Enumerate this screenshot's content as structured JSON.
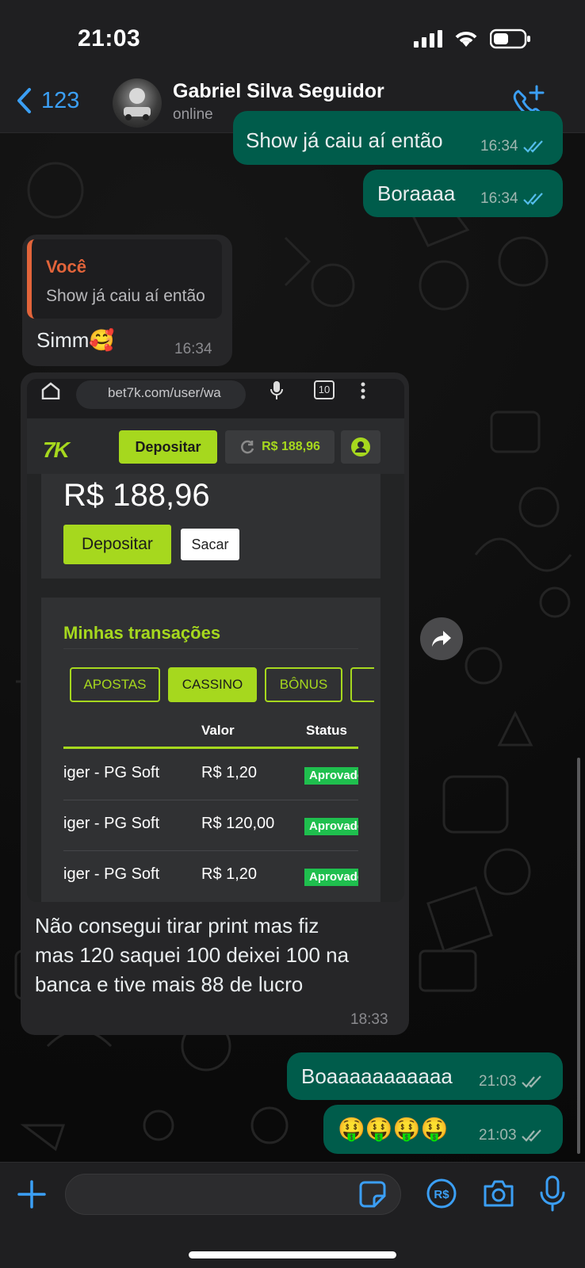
{
  "status_bar": {
    "time": "21:03"
  },
  "header": {
    "back_count": "123",
    "contact_name": "Gabriel Silva Seguidor",
    "contact_status": "online"
  },
  "messages": [
    {
      "id": "m1",
      "dir": "out",
      "text": "Show já caiu aí então",
      "time": "16:34"
    },
    {
      "id": "m2",
      "dir": "out",
      "text": "Boraaaa",
      "time": "16:34"
    },
    {
      "id": "m3",
      "dir": "in",
      "reply_author": "Você",
      "reply_text": "Show já caiu aí então",
      "text": "Simm🥰",
      "time": "16:34"
    },
    {
      "id": "m4",
      "dir": "in",
      "caption": "Não consegui tirar print mas fiz\nmas 120 saquei 100 deixei 100 na\nbanca e tive mais 88 de lucro",
      "time": "18:33"
    },
    {
      "id": "m5",
      "dir": "out",
      "text": "Boaaaaaaaaaaa",
      "time": "21:03"
    },
    {
      "id": "m6",
      "dir": "out",
      "text": "🤑🤑🤑🤑",
      "time": "21:03"
    }
  ],
  "screenshot": {
    "url": "bet7k.com/user/wa",
    "tab_count": "10",
    "logo": "7K",
    "nav_deposit": "Depositar",
    "nav_balance": "R$ 188,96",
    "balance": "R$ 188,96",
    "deposit_button": "Depositar",
    "withdraw_button": "Sacar",
    "transactions_title": "Minhas transações",
    "tabs": [
      "APOSTAS",
      "CASSINO",
      "BÔNUS"
    ],
    "active_tab": "CASSINO",
    "columns": [
      "Valor",
      "Status"
    ],
    "rows": [
      {
        "game": "iger - PG Soft",
        "value": "R$ 1,20",
        "status": "Aprovado"
      },
      {
        "game": "iger - PG Soft",
        "value": "R$ 120,00",
        "status": "Aprovado"
      },
      {
        "game": "iger - PG Soft",
        "value": "R$ 1,20",
        "status": "Aprovado"
      }
    ]
  },
  "icons": {
    "back": "chevron-left-icon",
    "call": "add-call-icon",
    "read": "double-check-icon",
    "forward": "forward-icon",
    "plus": "plus-icon",
    "sticker": "sticker-icon",
    "pay": "pix-payment-icon",
    "camera": "camera-icon",
    "mic": "microphone-icon"
  },
  "colors": {
    "outgoing_bubble": "#005c4b",
    "incoming_bubble": "#262628",
    "accent_blue": "#3b9ff5",
    "brand_green": "#a6d81e",
    "reply_orange": "#e2643a"
  }
}
